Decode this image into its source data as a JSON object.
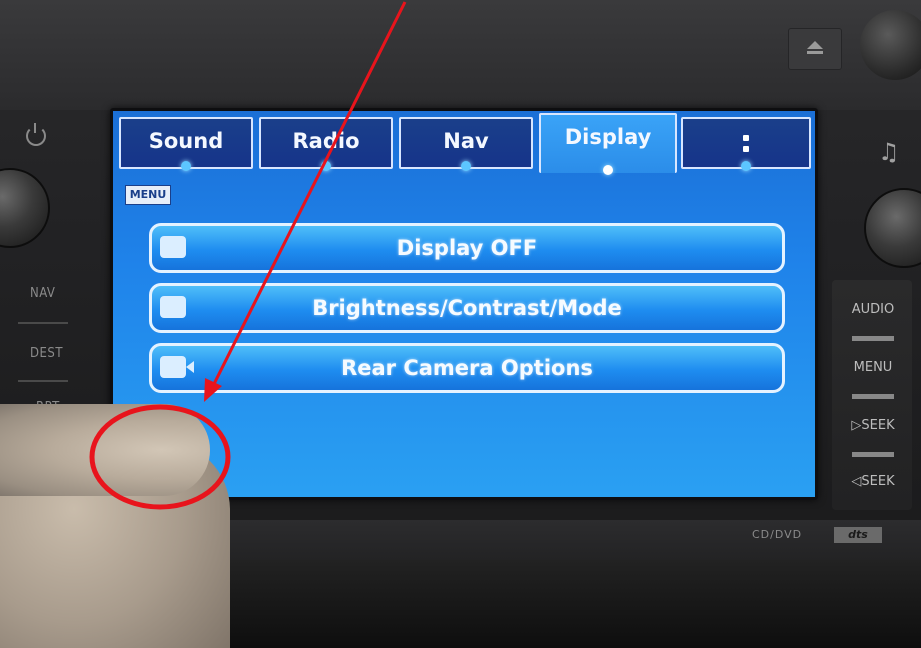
{
  "tabs": [
    {
      "label": "Sound",
      "active": false
    },
    {
      "label": "Radio",
      "active": false
    },
    {
      "label": "Nav",
      "active": false
    },
    {
      "label": "Display",
      "active": true
    },
    {
      "label": "⋮",
      "active": false
    }
  ],
  "menu_badge": "MENU",
  "options": [
    {
      "label": "Display OFF",
      "icon": "display-icon"
    },
    {
      "label": "Brightness/Contrast/Mode",
      "icon": "brightness-icon"
    },
    {
      "label": "Rear Camera Options",
      "icon": "camera-icon"
    }
  ],
  "left_buttons": [
    "NAV",
    "DEST",
    "RPT"
  ],
  "right_buttons": [
    "AUDIO",
    "MENU",
    "▷SEEK",
    "◁SEEK"
  ],
  "icons": {
    "power": "power-icon",
    "music": "♫",
    "eject": "eject-icon"
  },
  "footer": {
    "brand_tag": "CD/DVD",
    "badge": "dts"
  },
  "colors": {
    "screen_blue": "#1f83ea",
    "tab_inactive": "#1a3f8a",
    "annotation_red": "#e8141c"
  }
}
